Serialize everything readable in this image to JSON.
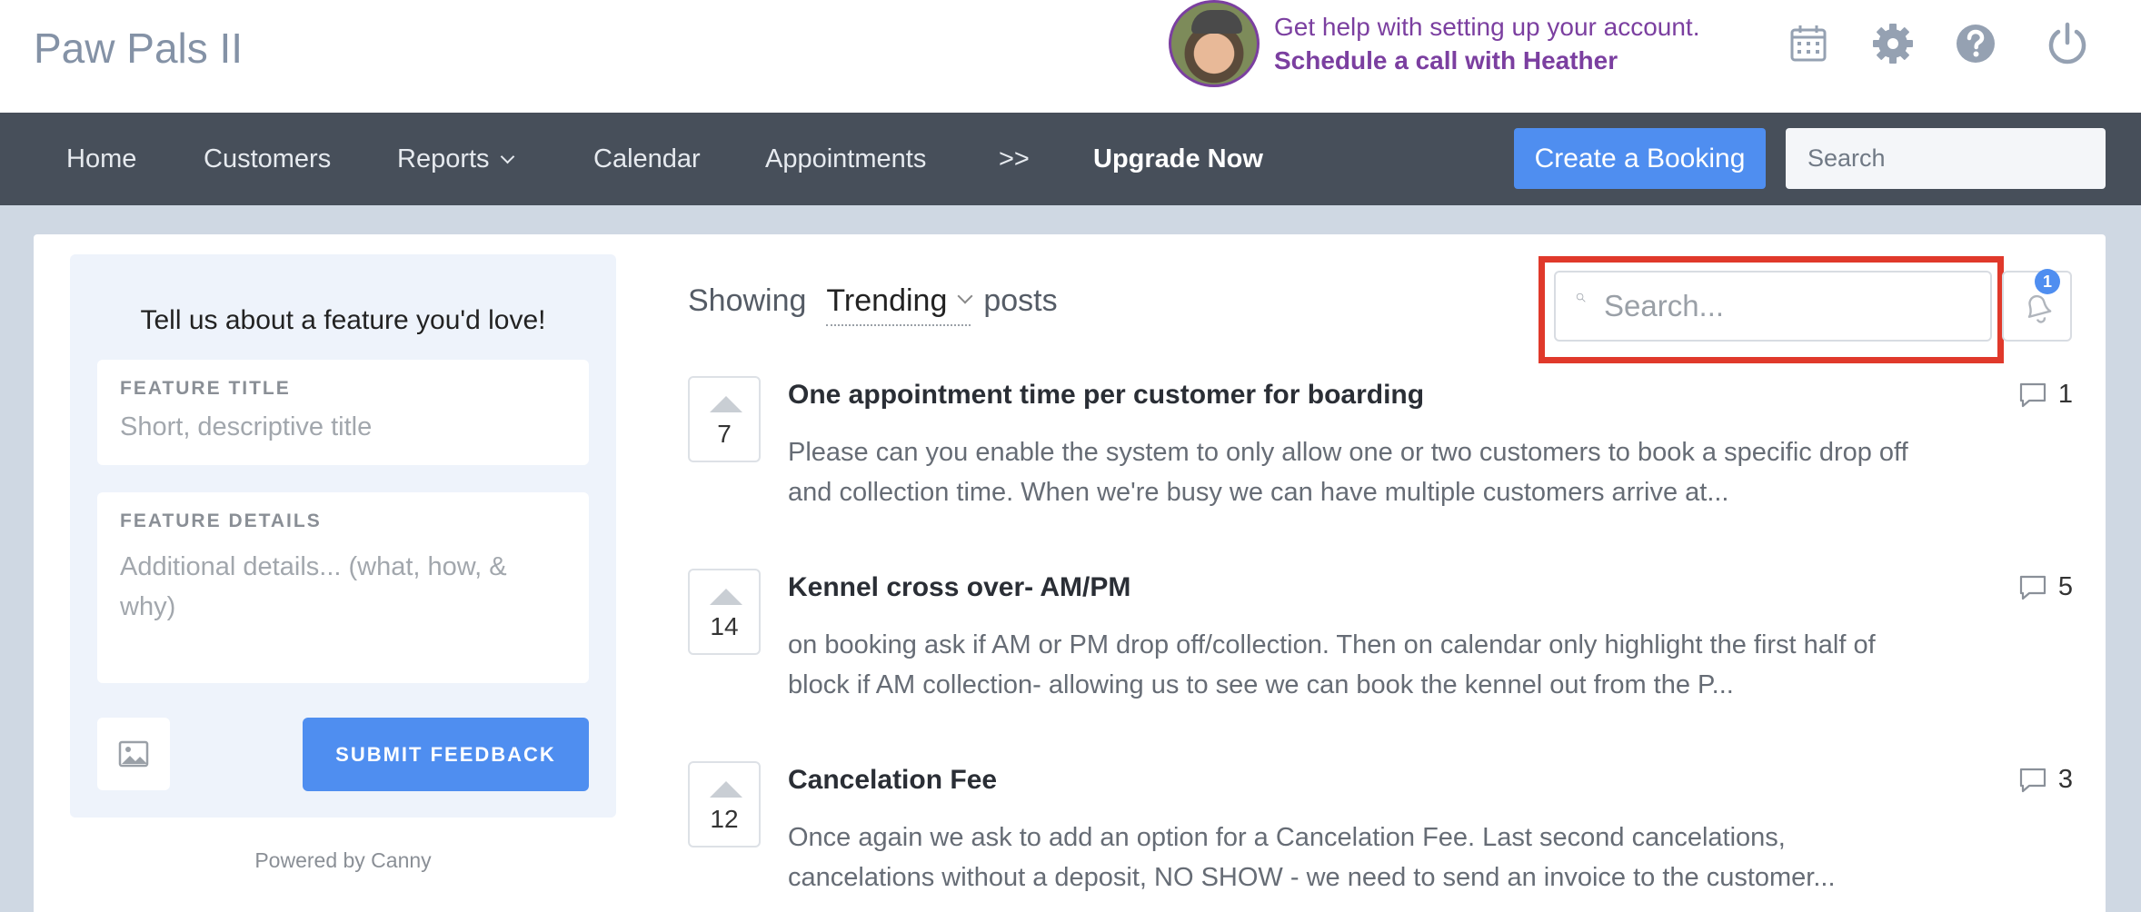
{
  "header": {
    "brand": "Paw Pals II",
    "help_line1": "Get help with setting up your account.",
    "help_line2": "Schedule a call with Heather",
    "icons": [
      "calendar-icon",
      "gear-icon",
      "help-icon",
      "power-icon"
    ]
  },
  "nav": {
    "items": [
      "Home",
      "Customers",
      "Reports",
      "Calendar",
      "Appointments",
      ">>",
      "Upgrade Now"
    ],
    "create_booking": "Create a Booking",
    "search_placeholder": "Search"
  },
  "sidebar": {
    "title": "Tell us about a feature you'd love!",
    "feature_title_label": "FEATURE TITLE",
    "feature_title_placeholder": "Short, descriptive title",
    "feature_details_label": "FEATURE DETAILS",
    "feature_details_placeholder": "Additional details... (what, how, & why)",
    "submit_label": "SUBMIT FEEDBACK",
    "powered_by": "Powered by Canny"
  },
  "feed": {
    "showing_label": "Showing",
    "sort_value": "Trending",
    "posts_label": "posts",
    "search_placeholder": "Search...",
    "notification_count": "1",
    "posts": [
      {
        "votes": "7",
        "title": "One appointment time per customer for boarding",
        "body": "Please can you enable the system to only allow one or two customers to book a specific drop off and collection time. When we're busy we can have multiple customers arrive at...",
        "comments": "1"
      },
      {
        "votes": "14",
        "title": "Kennel cross over- AM/PM",
        "body": "on booking ask if AM or PM drop off/collection. Then on calendar only highlight the first half of block if AM collection- allowing us to see we can book the kennel out from the P...",
        "comments": "5"
      },
      {
        "votes": "12",
        "title": "Cancelation Fee",
        "body": "Once again we ask to add an option for a Cancelation Fee. Last second cancelations, cancelations without a deposit, NO SHOW - we need to send an invoice to the customer...",
        "comments": "3"
      }
    ]
  },
  "colors": {
    "accent": "#4f8ef0",
    "nav_bg": "#474f5a",
    "highlight": "#e0392b",
    "help_purple": "#7b3fa0"
  }
}
